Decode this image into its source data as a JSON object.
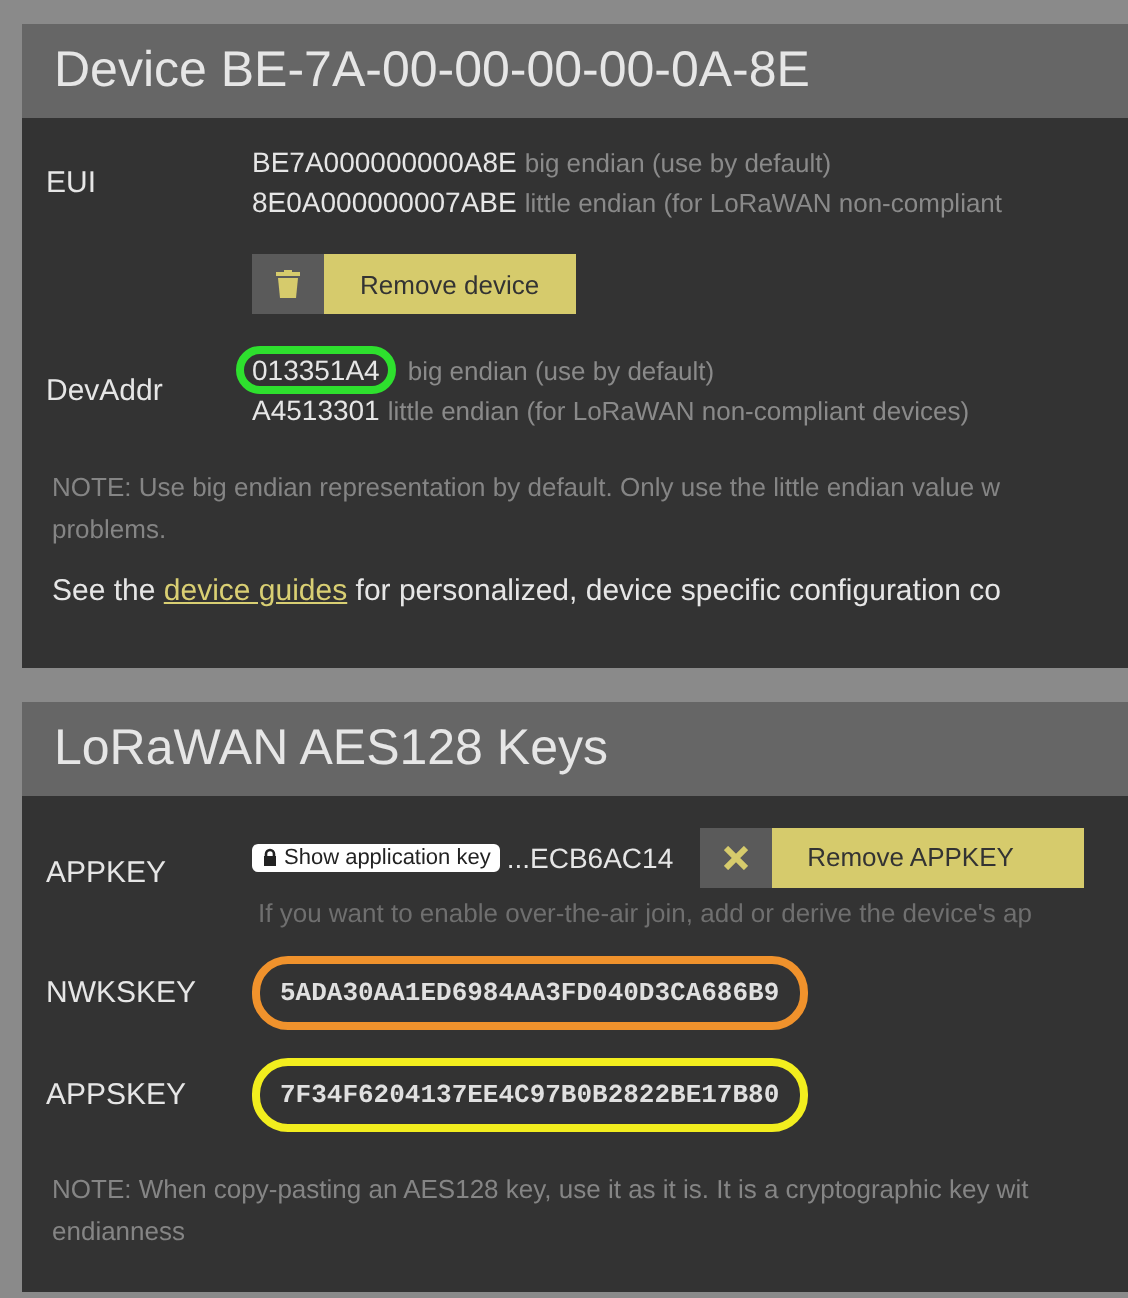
{
  "device_panel": {
    "title": "Device BE-7A-00-00-00-00-0A-8E",
    "eui": {
      "label": "EUI",
      "values": [
        {
          "value": "BE7A000000000A8E",
          "note": "big endian (use by default)"
        },
        {
          "value": "8E0A000000007ABE",
          "note": "little endian (for LoRaWAN non-compliant"
        }
      ]
    },
    "remove_button": {
      "label": "Remove device"
    },
    "devaddr": {
      "label": "DevAddr",
      "values": [
        {
          "value": "013351A4",
          "note": "big endian (use by default)",
          "color": "#2ee02e"
        },
        {
          "value": "A4513301",
          "note": "little endian (for LoRaWAN non-compliant devices)"
        }
      ]
    },
    "note": [
      "NOTE: Use big endian representation by default. Only use the little endian value w",
      "problems."
    ],
    "guide": {
      "before": "See the",
      "link": "device guides",
      "after": "for personalized, device specific configuration co"
    }
  },
  "keys_panel": {
    "title": "LoRaWAN AES128 Keys",
    "appkey": {
      "label": "APPKEY",
      "show_button": "Show application key",
      "value": "...ECB6AC14",
      "remove_button": "Remove APPKEY",
      "hint": "If you want to enable over-the-air join, add or derive the device's ap"
    },
    "keys": [
      {
        "label": "NWKSKEY",
        "value": "5ADA30AA1ED6984AA3FD040D3CA686B9",
        "color": "#f0922c"
      },
      {
        "label": "APPSKEY",
        "value": "7F34F6204137EE4C97B0B2822BE17B80",
        "color": "#f2ee1e"
      }
    ],
    "note": [
      "NOTE: When copy-pasting an AES128 key, use it as it is. It is a cryptographic key wit",
      "endianness"
    ]
  }
}
